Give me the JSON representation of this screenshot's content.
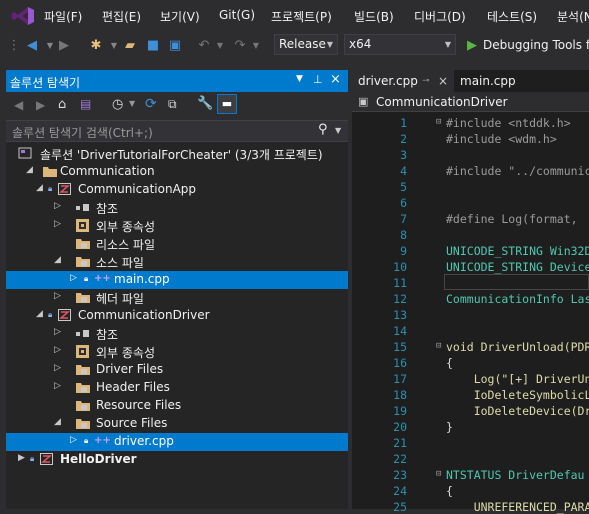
{
  "menu": [
    "파일(F)",
    "편집(E)",
    "보기(V)",
    "Git(G)",
    "프로젝트(P)",
    "빌드(B)",
    "디버그(D)",
    "테스트(S)",
    "분석(N)"
  ],
  "toolbar": {
    "config": "Release",
    "platform": "x64",
    "run_label": "Debugging Tools fo"
  },
  "solution_explorer": {
    "title": "솔루션 탐색기",
    "search_placeholder": "솔루션 탐색기 검색(Ctrl+;)",
    "rows": [
      {
        "label": "솔루션 'DriverTutorialForCheater' (3/3개 프로젝트)",
        "icon": "solution-icon"
      },
      {
        "label": "Communication",
        "icon": "folder-icon"
      },
      {
        "label": "CommunicationApp",
        "icon": "project-icon"
      },
      {
        "label": "참조",
        "icon": "references-icon"
      },
      {
        "label": "외부 종속성",
        "icon": "external-deps-icon"
      },
      {
        "label": "리소스 파일",
        "icon": "filter-folder-icon"
      },
      {
        "label": "소스 파일",
        "icon": "filter-folder-icon"
      },
      {
        "label": "main.cpp",
        "icon": "cpp-file-icon"
      },
      {
        "label": "헤더 파일",
        "icon": "filter-folder-icon"
      },
      {
        "label": "CommunicationDriver",
        "icon": "project-icon"
      },
      {
        "label": "참조",
        "icon": "references-icon"
      },
      {
        "label": "외부 종속성",
        "icon": "external-deps-icon"
      },
      {
        "label": "Driver Files",
        "icon": "filter-folder-icon"
      },
      {
        "label": "Header Files",
        "icon": "filter-folder-icon"
      },
      {
        "label": "Resource Files",
        "icon": "filter-folder-icon"
      },
      {
        "label": "Source Files",
        "icon": "filter-folder-icon"
      },
      {
        "label": "driver.cpp",
        "icon": "cpp-file-icon"
      },
      {
        "label": "HelloDriver",
        "icon": "project-icon"
      }
    ]
  },
  "editor": {
    "tabs": [
      "driver.cpp",
      "main.cpp"
    ],
    "nav_label": "CommunicationDriver",
    "lines": [
      {
        "n": "1",
        "t": "#include <ntddk.h>"
      },
      {
        "n": "2",
        "t": "#include <wdm.h>"
      },
      {
        "n": "3",
        "t": ""
      },
      {
        "n": "4",
        "t": "#include \"../communic"
      },
      {
        "n": "5",
        "t": ""
      },
      {
        "n": "6",
        "t": ""
      },
      {
        "n": "7",
        "t": "#define Log(format,"
      },
      {
        "n": "8",
        "t": ""
      },
      {
        "n": "9",
        "t": "UNICODE_STRING Win32D"
      },
      {
        "n": "10",
        "t": "UNICODE_STRING Device"
      },
      {
        "n": "11",
        "t": ""
      },
      {
        "n": "12",
        "t": "CommunicationInfo Las"
      },
      {
        "n": "13",
        "t": ""
      },
      {
        "n": "14",
        "t": ""
      },
      {
        "n": "15",
        "t": "void DriverUnload(PDR"
      },
      {
        "n": "16",
        "t": "{"
      },
      {
        "n": "17",
        "t": "    Log(\"[+] DriverUn"
      },
      {
        "n": "18",
        "t": "    IoDeleteSymbolicL"
      },
      {
        "n": "19",
        "t": "    IoDeleteDevice(Dr"
      },
      {
        "n": "20",
        "t": "}"
      },
      {
        "n": "21",
        "t": ""
      },
      {
        "n": "22",
        "t": ""
      },
      {
        "n": "23",
        "t": "NTSTATUS DriverDefau"
      },
      {
        "n": "24",
        "t": "{"
      },
      {
        "n": "25",
        "t": "    UNREFERENCED_PARA"
      }
    ]
  }
}
